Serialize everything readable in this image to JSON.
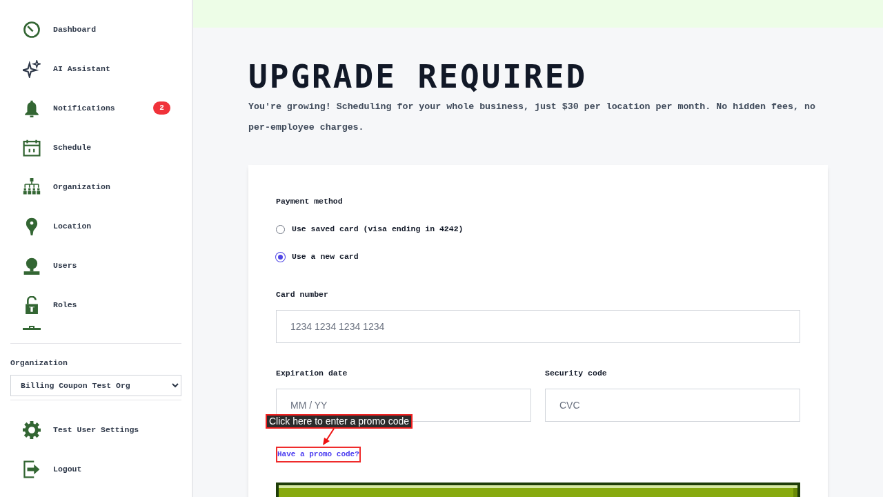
{
  "sidebar": {
    "nav_items": [
      {
        "label": "Dashboard"
      },
      {
        "label": "AI Assistant"
      },
      {
        "label": "Notifications",
        "badge": "2"
      },
      {
        "label": "Schedule"
      },
      {
        "label": "Organization"
      },
      {
        "label": "Location"
      },
      {
        "label": "Users"
      },
      {
        "label": "Roles"
      }
    ],
    "organization": {
      "label": "Organization",
      "value": "Billing Coupon Test Org"
    },
    "footer_items": [
      {
        "label": "Test User Settings"
      },
      {
        "label": "Logout"
      }
    ]
  },
  "page": {
    "title": "UPGRADE REQUIRED",
    "description": "You're growing! Scheduling for your whole business, just $30 per location per month. No hidden fees, no per-employee charges."
  },
  "payment_form": {
    "payment_method_label": "Payment method",
    "options": [
      {
        "label": "Use saved card (visa ending in 4242)",
        "selected": false
      },
      {
        "label": "Use a new card",
        "selected": true
      }
    ],
    "card_number": {
      "label": "Card number",
      "placeholder": "1234 1234 1234 1234"
    },
    "expiration": {
      "label": "Expiration date",
      "placeholder": "MM / YY"
    },
    "security_code": {
      "label": "Security code",
      "placeholder": "CVC"
    },
    "promo_link": "Have a promo code?"
  },
  "annotation": {
    "tooltip": "Click here to enter a promo code"
  }
}
